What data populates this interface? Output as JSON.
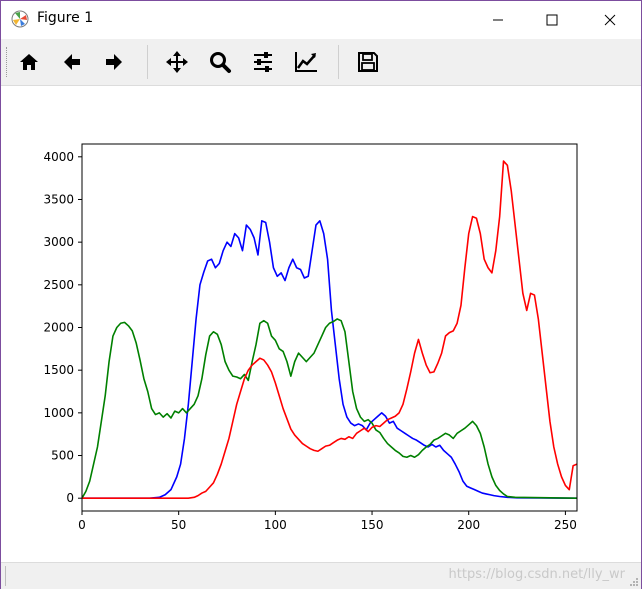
{
  "window": {
    "title": "Figure 1"
  },
  "toolbar": {
    "buttons": [
      "home-icon",
      "back-arrow-icon",
      "forward-arrow-icon",
      "pan-icon",
      "zoom-icon",
      "configure-subplots-icon",
      "edit-axes-icon",
      "save-icon"
    ]
  },
  "status": {
    "watermark": "https://blog.csdn.net/lly_wr"
  },
  "colors": {
    "blue": "#0000ff",
    "green": "#008000",
    "red": "#ff0000"
  },
  "chart_data": {
    "type": "line",
    "title": "",
    "xlabel": "",
    "ylabel": "",
    "xlim": [
      0,
      256
    ],
    "ylim": [
      -150,
      4150
    ],
    "xticks": [
      0,
      50,
      100,
      150,
      200,
      250
    ],
    "yticks": [
      0,
      500,
      1000,
      1500,
      2000,
      2500,
      3000,
      3500,
      4000
    ],
    "grid": false,
    "series": [
      {
        "color": "#0000ff",
        "points": [
          [
            0,
            0
          ],
          [
            35,
            0
          ],
          [
            40,
            10
          ],
          [
            43,
            40
          ],
          [
            46,
            100
          ],
          [
            49,
            250
          ],
          [
            51,
            400
          ],
          [
            53,
            700
          ],
          [
            55,
            1100
          ],
          [
            57,
            1600
          ],
          [
            59,
            2100
          ],
          [
            61,
            2500
          ],
          [
            63,
            2650
          ],
          [
            65,
            2780
          ],
          [
            67,
            2800
          ],
          [
            69,
            2700
          ],
          [
            71,
            2750
          ],
          [
            73,
            2900
          ],
          [
            75,
            3000
          ],
          [
            77,
            2950
          ],
          [
            79,
            3100
          ],
          [
            81,
            3050
          ],
          [
            83,
            2900
          ],
          [
            85,
            3200
          ],
          [
            87,
            3150
          ],
          [
            89,
            3050
          ],
          [
            91,
            2850
          ],
          [
            93,
            3250
          ],
          [
            95,
            3230
          ],
          [
            97,
            3000
          ],
          [
            99,
            2700
          ],
          [
            101,
            2600
          ],
          [
            103,
            2640
          ],
          [
            105,
            2550
          ],
          [
            107,
            2700
          ],
          [
            109,
            2800
          ],
          [
            111,
            2700
          ],
          [
            113,
            2680
          ],
          [
            115,
            2580
          ],
          [
            117,
            2600
          ],
          [
            119,
            2900
          ],
          [
            121,
            3200
          ],
          [
            123,
            3250
          ],
          [
            125,
            3100
          ],
          [
            127,
            2800
          ],
          [
            129,
            2200
          ],
          [
            131,
            1800
          ],
          [
            133,
            1400
          ],
          [
            135,
            1100
          ],
          [
            137,
            950
          ],
          [
            139,
            880
          ],
          [
            141,
            850
          ],
          [
            143,
            870
          ],
          [
            145,
            850
          ],
          [
            147,
            800
          ],
          [
            149,
            880
          ],
          [
            151,
            920
          ],
          [
            153,
            960
          ],
          [
            155,
            1000
          ],
          [
            157,
            960
          ],
          [
            159,
            880
          ],
          [
            161,
            900
          ],
          [
            163,
            820
          ],
          [
            165,
            790
          ],
          [
            167,
            760
          ],
          [
            169,
            730
          ],
          [
            171,
            700
          ],
          [
            173,
            680
          ],
          [
            175,
            650
          ],
          [
            177,
            620
          ],
          [
            179,
            600
          ],
          [
            181,
            630
          ],
          [
            183,
            600
          ],
          [
            185,
            620
          ],
          [
            187,
            560
          ],
          [
            189,
            520
          ],
          [
            191,
            480
          ],
          [
            193,
            400
          ],
          [
            195,
            310
          ],
          [
            197,
            200
          ],
          [
            199,
            140
          ],
          [
            201,
            120
          ],
          [
            203,
            100
          ],
          [
            205,
            80
          ],
          [
            207,
            60
          ],
          [
            209,
            50
          ],
          [
            211,
            40
          ],
          [
            213,
            30
          ],
          [
            216,
            20
          ],
          [
            220,
            10
          ],
          [
            225,
            5
          ],
          [
            256,
            0
          ]
        ]
      },
      {
        "color": "#008000",
        "points": [
          [
            0,
            0
          ],
          [
            2,
            80
          ],
          [
            4,
            200
          ],
          [
            6,
            400
          ],
          [
            8,
            600
          ],
          [
            10,
            900
          ],
          [
            12,
            1200
          ],
          [
            14,
            1600
          ],
          [
            16,
            1900
          ],
          [
            18,
            2000
          ],
          [
            20,
            2050
          ],
          [
            22,
            2060
          ],
          [
            24,
            2020
          ],
          [
            26,
            1960
          ],
          [
            28,
            1820
          ],
          [
            30,
            1620
          ],
          [
            32,
            1400
          ],
          [
            34,
            1250
          ],
          [
            36,
            1050
          ],
          [
            38,
            980
          ],
          [
            40,
            1000
          ],
          [
            42,
            950
          ],
          [
            44,
            990
          ],
          [
            46,
            940
          ],
          [
            48,
            1020
          ],
          [
            50,
            1000
          ],
          [
            52,
            1050
          ],
          [
            54,
            1000
          ],
          [
            56,
            1050
          ],
          [
            58,
            1100
          ],
          [
            60,
            1200
          ],
          [
            62,
            1400
          ],
          [
            64,
            1680
          ],
          [
            66,
            1900
          ],
          [
            68,
            1950
          ],
          [
            70,
            1920
          ],
          [
            72,
            1800
          ],
          [
            74,
            1600
          ],
          [
            76,
            1500
          ],
          [
            78,
            1430
          ],
          [
            80,
            1420
          ],
          [
            82,
            1400
          ],
          [
            84,
            1450
          ],
          [
            86,
            1380
          ],
          [
            88,
            1600
          ],
          [
            90,
            1800
          ],
          [
            92,
            2050
          ],
          [
            94,
            2080
          ],
          [
            96,
            2050
          ],
          [
            98,
            1900
          ],
          [
            100,
            1850
          ],
          [
            102,
            1750
          ],
          [
            104,
            1720
          ],
          [
            106,
            1600
          ],
          [
            108,
            1430
          ],
          [
            110,
            1600
          ],
          [
            112,
            1700
          ],
          [
            114,
            1650
          ],
          [
            116,
            1600
          ],
          [
            118,
            1650
          ],
          [
            120,
            1700
          ],
          [
            122,
            1800
          ],
          [
            124,
            1900
          ],
          [
            126,
            2000
          ],
          [
            128,
            2050
          ],
          [
            130,
            2070
          ],
          [
            132,
            2100
          ],
          [
            134,
            2080
          ],
          [
            136,
            1950
          ],
          [
            138,
            1600
          ],
          [
            140,
            1250
          ],
          [
            142,
            1050
          ],
          [
            144,
            950
          ],
          [
            146,
            900
          ],
          [
            148,
            920
          ],
          [
            150,
            880
          ],
          [
            152,
            800
          ],
          [
            154,
            770
          ],
          [
            156,
            700
          ],
          [
            158,
            640
          ],
          [
            160,
            600
          ],
          [
            162,
            560
          ],
          [
            164,
            530
          ],
          [
            166,
            490
          ],
          [
            168,
            480
          ],
          [
            170,
            500
          ],
          [
            172,
            480
          ],
          [
            174,
            510
          ],
          [
            176,
            560
          ],
          [
            178,
            600
          ],
          [
            180,
            630
          ],
          [
            182,
            680
          ],
          [
            184,
            700
          ],
          [
            186,
            730
          ],
          [
            188,
            760
          ],
          [
            190,
            740
          ],
          [
            192,
            700
          ],
          [
            194,
            760
          ],
          [
            196,
            790
          ],
          [
            198,
            820
          ],
          [
            200,
            860
          ],
          [
            202,
            900
          ],
          [
            204,
            850
          ],
          [
            206,
            760
          ],
          [
            208,
            600
          ],
          [
            210,
            400
          ],
          [
            212,
            250
          ],
          [
            214,
            150
          ],
          [
            216,
            90
          ],
          [
            218,
            50
          ],
          [
            220,
            20
          ],
          [
            224,
            10
          ],
          [
            256,
            0
          ]
        ]
      },
      {
        "color": "#ff0000",
        "points": [
          [
            0,
            0
          ],
          [
            55,
            0
          ],
          [
            58,
            10
          ],
          [
            60,
            30
          ],
          [
            62,
            60
          ],
          [
            64,
            80
          ],
          [
            66,
            130
          ],
          [
            68,
            180
          ],
          [
            70,
            280
          ],
          [
            72,
            400
          ],
          [
            74,
            550
          ],
          [
            76,
            700
          ],
          [
            78,
            900
          ],
          [
            80,
            1100
          ],
          [
            82,
            1250
          ],
          [
            84,
            1400
          ],
          [
            86,
            1500
          ],
          [
            88,
            1560
          ],
          [
            90,
            1600
          ],
          [
            92,
            1640
          ],
          [
            94,
            1620
          ],
          [
            96,
            1560
          ],
          [
            98,
            1480
          ],
          [
            100,
            1350
          ],
          [
            102,
            1200
          ],
          [
            104,
            1050
          ],
          [
            106,
            930
          ],
          [
            108,
            810
          ],
          [
            110,
            740
          ],
          [
            112,
            690
          ],
          [
            114,
            640
          ],
          [
            116,
            610
          ],
          [
            118,
            580
          ],
          [
            120,
            560
          ],
          [
            122,
            550
          ],
          [
            124,
            580
          ],
          [
            126,
            610
          ],
          [
            128,
            620
          ],
          [
            130,
            650
          ],
          [
            132,
            680
          ],
          [
            134,
            700
          ],
          [
            136,
            690
          ],
          [
            138,
            720
          ],
          [
            140,
            700
          ],
          [
            142,
            760
          ],
          [
            144,
            790
          ],
          [
            146,
            820
          ],
          [
            148,
            780
          ],
          [
            150,
            830
          ],
          [
            152,
            850
          ],
          [
            154,
            840
          ],
          [
            156,
            880
          ],
          [
            158,
            920
          ],
          [
            160,
            940
          ],
          [
            162,
            960
          ],
          [
            164,
            1000
          ],
          [
            166,
            1100
          ],
          [
            168,
            1280
          ],
          [
            170,
            1480
          ],
          [
            172,
            1700
          ],
          [
            174,
            1860
          ],
          [
            176,
            1700
          ],
          [
            178,
            1560
          ],
          [
            180,
            1470
          ],
          [
            182,
            1480
          ],
          [
            184,
            1580
          ],
          [
            186,
            1700
          ],
          [
            188,
            1900
          ],
          [
            190,
            1940
          ],
          [
            192,
            1960
          ],
          [
            194,
            2050
          ],
          [
            196,
            2260
          ],
          [
            198,
            2700
          ],
          [
            200,
            3100
          ],
          [
            202,
            3300
          ],
          [
            204,
            3280
          ],
          [
            206,
            3100
          ],
          [
            208,
            2800
          ],
          [
            210,
            2700
          ],
          [
            212,
            2640
          ],
          [
            214,
            2900
          ],
          [
            216,
            3300
          ],
          [
            218,
            3950
          ],
          [
            220,
            3900
          ],
          [
            222,
            3600
          ],
          [
            224,
            3200
          ],
          [
            226,
            2800
          ],
          [
            228,
            2400
          ],
          [
            230,
            2200
          ],
          [
            232,
            2400
          ],
          [
            234,
            2380
          ],
          [
            236,
            2100
          ],
          [
            238,
            1700
          ],
          [
            240,
            1300
          ],
          [
            242,
            900
          ],
          [
            244,
            600
          ],
          [
            246,
            400
          ],
          [
            248,
            250
          ],
          [
            250,
            150
          ],
          [
            252,
            100
          ],
          [
            254,
            380
          ],
          [
            256,
            400
          ]
        ]
      }
    ]
  }
}
